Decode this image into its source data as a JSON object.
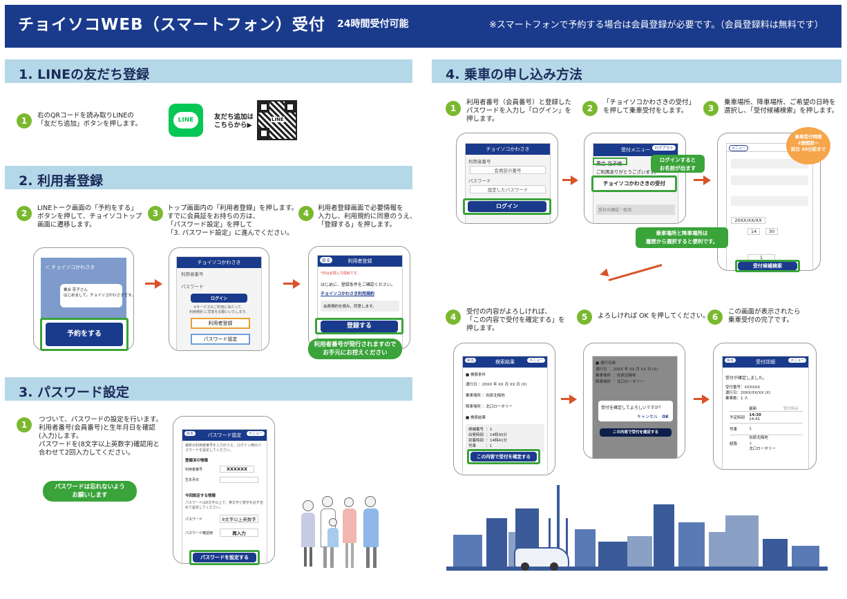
{
  "header": {
    "title": "チョイソコWEB（スマートフォン）受付",
    "sub": "24時間受付可能",
    "note": "※スマートフォンで予約する場合は会員登録が必要です。（会員登録料は無料です）"
  },
  "sec1": {
    "title": "1.  LINEの友だち登録",
    "step1": "右のQRコードを読み取りLINEの\n「友だち追加」ボタンを押します。",
    "line_logo": "LINE",
    "qr_text": "友だち追加は\nこちらから▶",
    "qr_label": "LINE"
  },
  "sec2": {
    "title": "2.  利用者登録",
    "step2": "LINEトーク画面の「予約をする」\nボタンを押して、チョイソコトップ\n画面に遷移します。",
    "step3": "トップ画面内の「利用者登録」を押します。\nすでに会員証をお持ちの方は、\n「パスワード設定」を押して\n「3. パスワード設定」に進んでください。",
    "step4": "利用者登録画面で必要情報を\n入力し、利用規約に同意のうえ、\n「登録する」を押します。",
    "p1_header": "＜ チョイソコかわさき",
    "p1_msg": "乗合 花子さん\nはじめまして。チョイソコかわさきです。",
    "p1_btn": "予約をする",
    "p2_bar": "チョイソコかわさき",
    "p2_label1": "利用者番号",
    "p2_label2": "パスワード",
    "p2_login": "ログイン",
    "p2_note": "※サービスのご利用にあたって、\n利用規約 に同意をお願いいたします。",
    "p2_reg": "利用者登録",
    "p2_pw": "パスワード設定",
    "p3_back": "戻る",
    "p3_bar": "利用者登録",
    "p3_req": "*印は必須入力項目です。",
    "p3_intro": "はじめに、登録条件をご確認ください。",
    "p3_link": "チョイソコかわさき利用規約",
    "p3_check": "会員規約を読み、同意します。",
    "p3_btn": "登録する",
    "pill": "利用者番号が発行されますので\nお手元にお控えください"
  },
  "sec3": {
    "title": "3.  パスワード設定",
    "step1": "つづいて、パスワードの設定を行います。\n利用者番号(会員番号)と生年月日を確認\n(入力)します。\nパスワードを(8文字以上英数字)確認用と\n合わせて2回入力してください。",
    "pill": "パスワードは忘れないよう\nお願いします",
    "p_back": "戻る",
    "p_bar": "パスワード設定",
    "p_menu": "メニュー",
    "p_intro": "最新の利用者番号を入力のうえ、ログイン用のパスワードを設定してください。",
    "p_h1": "登録済の情報",
    "p_l1": "利用者番号",
    "p_v1": "XXXXXX",
    "p_l2": "生年月日",
    "p_h2": "今回設定する情報",
    "p_note2": "パスワードは8文字以上で、英文字と数字を必ず含めて設定してください。",
    "p_l3": "パスワード",
    "p_v3": "8文字以上英数字",
    "p_l4": "パスワード確認用",
    "p_v4": "再入力",
    "p_btn": "パスワードを設定する"
  },
  "sec4": {
    "title": "4.  乗車の申し込み方法",
    "s1": "利用者番号（会員番号）と登録した\nパスワードを入力し「ログイン」を\n押します。",
    "s2": "「チョイソコかわさきの受付」\nを押して乗車受付をします。",
    "s3": "乗車場所、降車場所、ご希望の日時を\n選択し、「受付候補検索」を押します。",
    "s4": "受付の内容がよろしければ、\n「この内容で受付を確定する」を\n押します。",
    "s5": "よろしければ OK を押してください。",
    "s6": "この画面が表示されたら\n乗車受付の完了です。",
    "a_bar": "チョイソコかわさき",
    "a_l1": "利用者番号",
    "a_v1": "会員証の番号",
    "a_l2": "パスワード",
    "a_v2": "設定したパスワード",
    "a_btn": "ログイン",
    "b_bar": "受付メニュー",
    "b_logout": "ログアウト",
    "b_name": "乗合 花子様",
    "b_thanks": "ご利用ありがとうございます。",
    "b_btn": "チョイソコかわさきの受付",
    "b_cancel": "受付の確認・取消",
    "b_callout": "ログインすると\nお名前が出ます",
    "c_badge_title": "乗車受付時間",
    "c_badge": "2週間前〜\n前日 30分前まで",
    "c_menu": "メニュー",
    "c_btn": "受付候補検索",
    "c_time": "20XX/XX/XX",
    "c_h": "14",
    "c_m": "30",
    "c_now": "1",
    "c_callout": "乗車場所と降車場所は\n履歴から選択すると便利です。",
    "d_back": "戻る",
    "d_bar": "検索結果",
    "d_menu": "メニュー",
    "d_h1": "■ 検索条件",
    "d_r1": "運行日  ：20XX 年 XX 月 XX 日 (X)",
    "d_r2": "乗車場所  ：向原北梅地",
    "d_r3": "降車場所  ：北口ロータリー",
    "d_h2": "■ 検索結果",
    "d_res": "候補番号  ：1\n出発時刻  ：14時30分\n到着時刻  ：14時41分\n号車        ：1",
    "d_btn": "この内容で受付を確定する",
    "e_dialog": "受付を確定してよろしいですか？",
    "e_cancel": "キャンセル",
    "e_ok": "OK",
    "e_bottom": "この内容で受付を確定する",
    "e_lines": "■ 運行日時\n運行日  ：20XX 年 XX 月 XX 日 (X)\n乗車場所  ：向原北梅地\n降車場所  ：北口ロータリー",
    "f_back": "戻る",
    "f_bar": "受付詳細",
    "f_menu": "メニュー",
    "f_msg": "受付が確定しました。",
    "f_info": "受付番号：XXXXXX\n運行日：20XX/XX/XX (X)\n乗車数：1 人",
    "f_col1": "最新",
    "f_col2": "受付時点",
    "f_row1": "予定時刻",
    "f_v1": "14:30",
    "f_v1b": "14:41",
    "f_row2": "号車",
    "f_v2": "1",
    "f_row3": "経路",
    "f_v3": "向原北梅地\n↓\n北口ロータリー"
  }
}
